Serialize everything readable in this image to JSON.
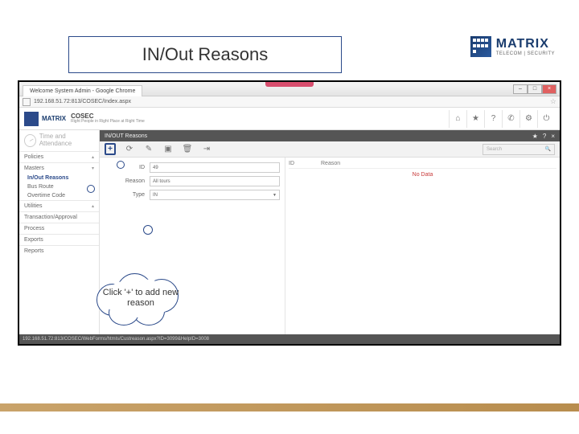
{
  "slide": {
    "title": "IN/Out Reasons",
    "logo_main": "MATRIX",
    "logo_sub": "TELECOM | SECURITY"
  },
  "browser": {
    "tab_title": "Welcome System Admin - Google Chrome",
    "url": "192.168.51.72:813/COSEC/Index.aspx",
    "status": "192.168.51.72:813/COSEC/WebForms/htmls/Custreason.aspx?ID=3099&HelpID=3008"
  },
  "app": {
    "brand": "MATRIX",
    "product": "COSEC",
    "tagline": "Right People in Right Place at Right Time"
  },
  "header_icons": {
    "home": "home-icon",
    "star": "star-icon",
    "help": "help-icon",
    "phone": "phone-icon",
    "settings": "settings-icon",
    "power": "power-icon"
  },
  "sidebar": {
    "module_label": "Time and\nAttendance",
    "masters_label": "Masters",
    "sections": [
      {
        "label": "Policies",
        "expanded": false
      },
      {
        "label": "Masters",
        "expanded": true
      }
    ],
    "items": [
      {
        "label": "In/Out Reasons",
        "active": true
      },
      {
        "label": "Bus Route",
        "active": false
      },
      {
        "label": "Overtime Code",
        "active": false
      }
    ],
    "sections2": [
      {
        "label": "Utilities"
      },
      {
        "label": "Transaction/Approval"
      },
      {
        "label": "Process"
      },
      {
        "label": "Exports"
      },
      {
        "label": "Reports"
      }
    ]
  },
  "panel": {
    "title": "IN/OUT Reasons",
    "search_placeholder": "Search"
  },
  "form": {
    "id_label": "ID",
    "id_value": "49",
    "reason_label": "Reason",
    "reason_value": "All tours",
    "type_label": "Type",
    "type_value": "IN"
  },
  "list": {
    "col1": "ID",
    "col2": "Reason",
    "no_data": "No Data"
  },
  "annotation": {
    "text": "Click '+' to add new reason"
  }
}
